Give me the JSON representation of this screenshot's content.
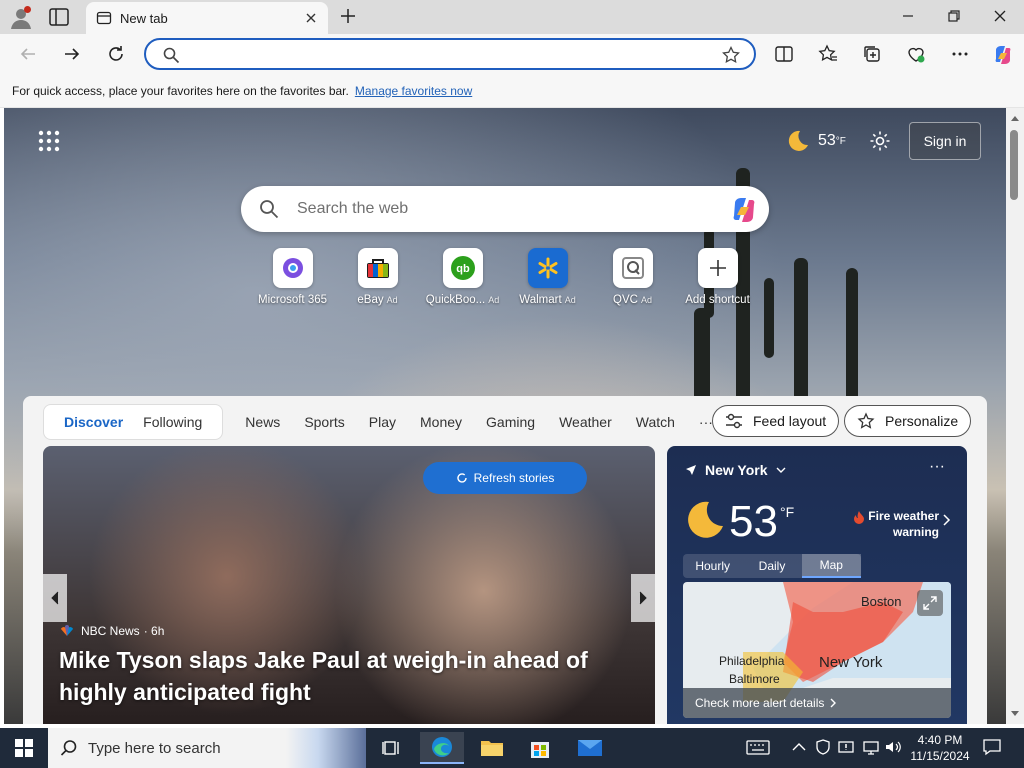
{
  "browser": {
    "tab_title": "New tab",
    "address_value": "",
    "favorites_hint": "For quick access, place your favorites here on the favorites bar.",
    "favorites_link": "Manage favorites now"
  },
  "newtab": {
    "weather_temp": "53",
    "weather_unit": "°F",
    "sign_in": "Sign in",
    "search_placeholder": "Search the web",
    "shortcuts": [
      {
        "label": "Microsoft 365",
        "ad": ""
      },
      {
        "label": "eBay",
        "ad": "Ad"
      },
      {
        "label": "QuickBoo...",
        "ad": "Ad"
      },
      {
        "label": "Walmart",
        "ad": "Ad"
      },
      {
        "label": "QVC",
        "ad": "Ad"
      },
      {
        "label": "Add shortcut",
        "ad": ""
      }
    ]
  },
  "feed": {
    "tabs": {
      "discover": "Discover",
      "following": "Following"
    },
    "nav": [
      "News",
      "Sports",
      "Play",
      "Money",
      "Gaming",
      "Weather",
      "Watch"
    ],
    "more": "···",
    "feed_layout": "Feed layout",
    "personalize": "Personalize",
    "hero": {
      "refresh": "Refresh stories",
      "source": "NBC News",
      "age": "· 6h",
      "headline": "Mike Tyson slaps Jake Paul at weigh-in ahead of highly anticipated fight"
    }
  },
  "weather_card": {
    "location": "New York",
    "temp": "53",
    "unit": "°F",
    "alert": "Fire weather warning",
    "tabs": [
      "Hourly",
      "Daily",
      "Map"
    ],
    "map_labels": {
      "boston": "Boston",
      "philadelphia": "Philadelphia",
      "new_york": "New York",
      "baltimore": "Baltimore"
    },
    "alert_details": "Check more alert details"
  },
  "taskbar": {
    "search_placeholder": "Type here to search",
    "time": "4:40 PM",
    "date": "11/15/2024"
  },
  "colors": {
    "accent": "#1f6fd1",
    "link": "#2363b8",
    "alert": "#e54b2e",
    "taskbar": "#1f2a3a"
  }
}
